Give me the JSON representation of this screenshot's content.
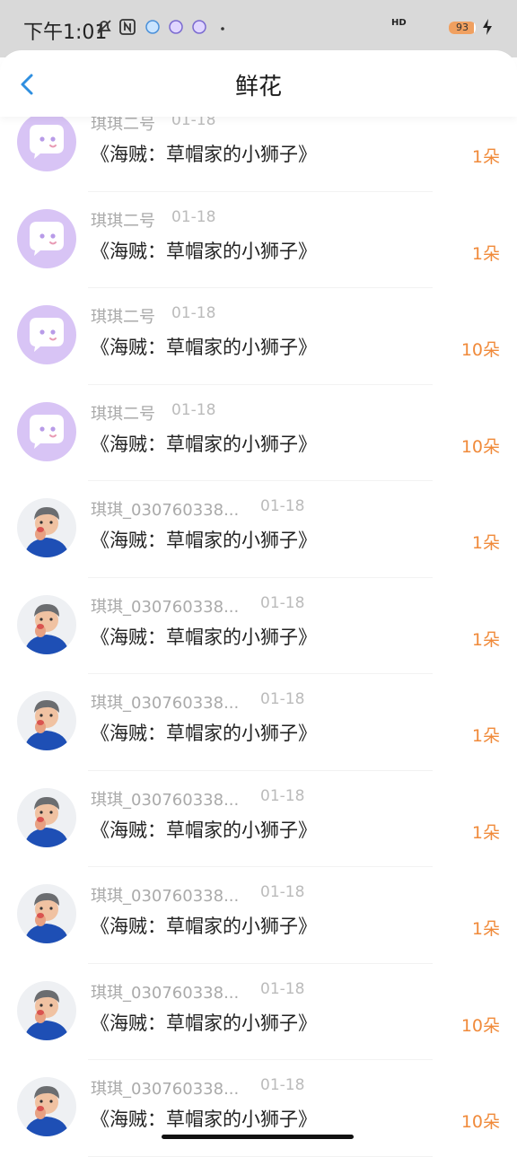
{
  "status_bar": {
    "time": "下午1:01",
    "network": "HD",
    "battery": "93",
    "battery_level": 0.93
  },
  "header": {
    "title": "鲜花"
  },
  "gifts": [
    {
      "name": "琪琪二号",
      "date": "01-18",
      "work": "《海贼：草帽家的小狮子》",
      "count": "1朵",
      "avatar": "placeholder"
    },
    {
      "name": "琪琪二号",
      "date": "01-18",
      "work": "《海贼：草帽家的小狮子》",
      "count": "1朵",
      "avatar": "placeholder"
    },
    {
      "name": "琪琪二号",
      "date": "01-18",
      "work": "《海贼：草帽家的小狮子》",
      "count": "10朵",
      "avatar": "placeholder"
    },
    {
      "name": "琪琪二号",
      "date": "01-18",
      "work": "《海贼：草帽家的小狮子》",
      "count": "10朵",
      "avatar": "placeholder"
    },
    {
      "name": "琪琪_030760338...",
      "date": "01-18",
      "work": "《海贼：草帽家的小狮子》",
      "count": "1朵",
      "avatar": "photo"
    },
    {
      "name": "琪琪_030760338...",
      "date": "01-18",
      "work": "《海贼：草帽家的小狮子》",
      "count": "1朵",
      "avatar": "photo"
    },
    {
      "name": "琪琪_030760338...",
      "date": "01-18",
      "work": "《海贼：草帽家的小狮子》",
      "count": "1朵",
      "avatar": "photo"
    },
    {
      "name": "琪琪_030760338...",
      "date": "01-18",
      "work": "《海贼：草帽家的小狮子》",
      "count": "1朵",
      "avatar": "photo"
    },
    {
      "name": "琪琪_030760338...",
      "date": "01-18",
      "work": "《海贼：草帽家的小狮子》",
      "count": "1朵",
      "avatar": "photo"
    },
    {
      "name": "琪琪_030760338...",
      "date": "01-18",
      "work": "《海贼：草帽家的小狮子》",
      "count": "10朵",
      "avatar": "photo"
    },
    {
      "name": "琪琪_030760338...",
      "date": "01-18",
      "work": "《海贼：草帽家的小狮子》",
      "count": "10朵",
      "avatar": "photo"
    }
  ],
  "colors": {
    "accent": "#f08a3a",
    "back_arrow": "#2f8fe0",
    "placeholder_avatar": "#d8c4f5"
  }
}
